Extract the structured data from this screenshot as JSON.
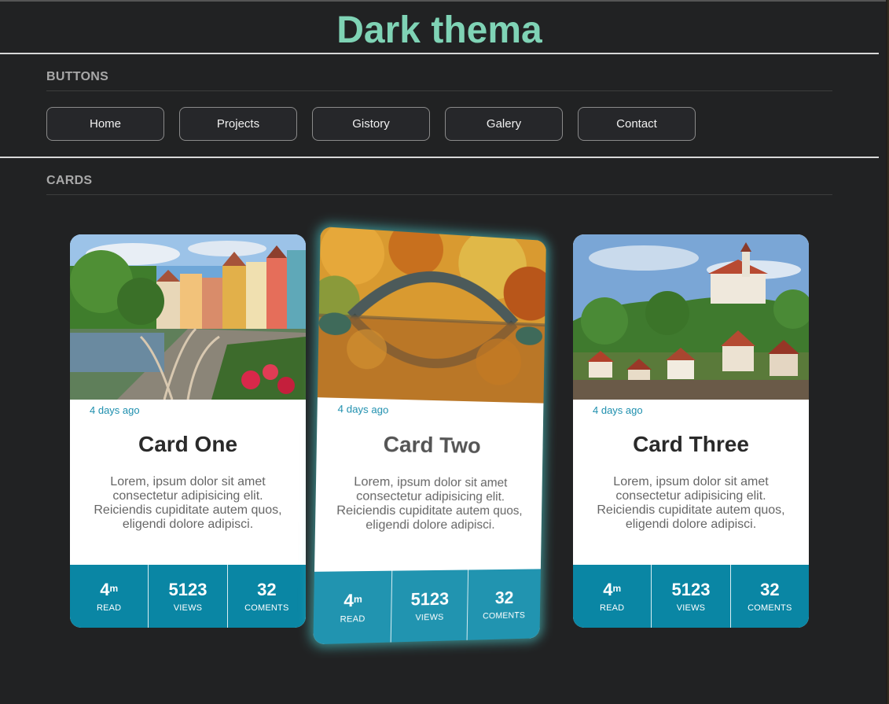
{
  "page": {
    "title": "Dark thema"
  },
  "sections": {
    "buttons": {
      "label": "BUTTONS"
    },
    "cards": {
      "label": "CARDS"
    }
  },
  "nav_buttons": [
    {
      "label": "Home"
    },
    {
      "label": "Projects"
    },
    {
      "label": "Gistory"
    },
    {
      "label": "Galery"
    },
    {
      "label": "Contact"
    }
  ],
  "cards": [
    {
      "date": "4 days ago",
      "title": "Card One",
      "body": "Lorem, ipsum dolor sit amet consectetur adipisicing elit. Reiciendis cupiditate autem quos, eligendi dolore adipisci.",
      "image": "town-riverside-photo",
      "stats": {
        "read_value": "4",
        "read_unit": "m",
        "read_label": "READ",
        "views_value": "5123",
        "views_label": "VIEWS",
        "comments_value": "32",
        "comments_label": "COMENTS"
      }
    },
    {
      "date": "4 days ago",
      "title": "Card Two",
      "body": "Lorem, ipsum dolor sit amet consectetur adipisicing elit. Reiciendis cupiditate autem quos, eligendi dolore adipisci.",
      "image": "autumn-bridge-photo",
      "stats": {
        "read_value": "4",
        "read_unit": "m",
        "read_label": "READ",
        "views_value": "5123",
        "views_label": "VIEWS",
        "comments_value": "32",
        "comments_label": "COMENTS"
      }
    },
    {
      "date": "4 days ago",
      "title": "Card Three",
      "body": "Lorem, ipsum dolor sit amet consectetur adipisicing elit. Reiciendis cupiditate autem quos, eligendi dolore adipisci.",
      "image": "castle-hill-photo",
      "stats": {
        "read_value": "4",
        "read_unit": "m",
        "read_label": "READ",
        "views_value": "5123",
        "views_label": "VIEWS",
        "comments_value": "32",
        "comments_label": "COMENTS"
      }
    }
  ],
  "colors": {
    "title": "#7fd3b5",
    "accent": "#0a86a4",
    "glow": "#50dcdc",
    "background": "#212223"
  }
}
